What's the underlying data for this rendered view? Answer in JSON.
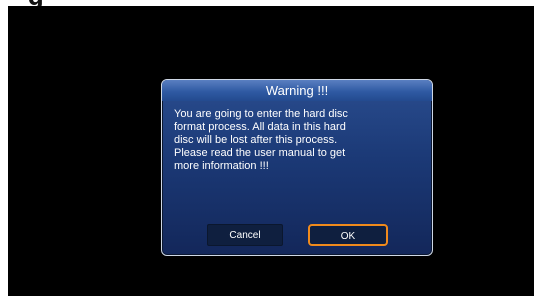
{
  "partial_top_text": "g",
  "dialog": {
    "title": "Warning !!!",
    "message": "You are going to enter the hard disc\nformat process. All data in this hard\ndisc will be lost after this process.\nPlease read the user manual to get\nmore information !!!",
    "buttons": {
      "cancel_label": "Cancel",
      "ok_label": "OK"
    },
    "focused_button": "ok"
  },
  "colors": {
    "focus_border": "#f08a1c",
    "dialog_background": "#1b3976",
    "screen_background": "#000000"
  }
}
